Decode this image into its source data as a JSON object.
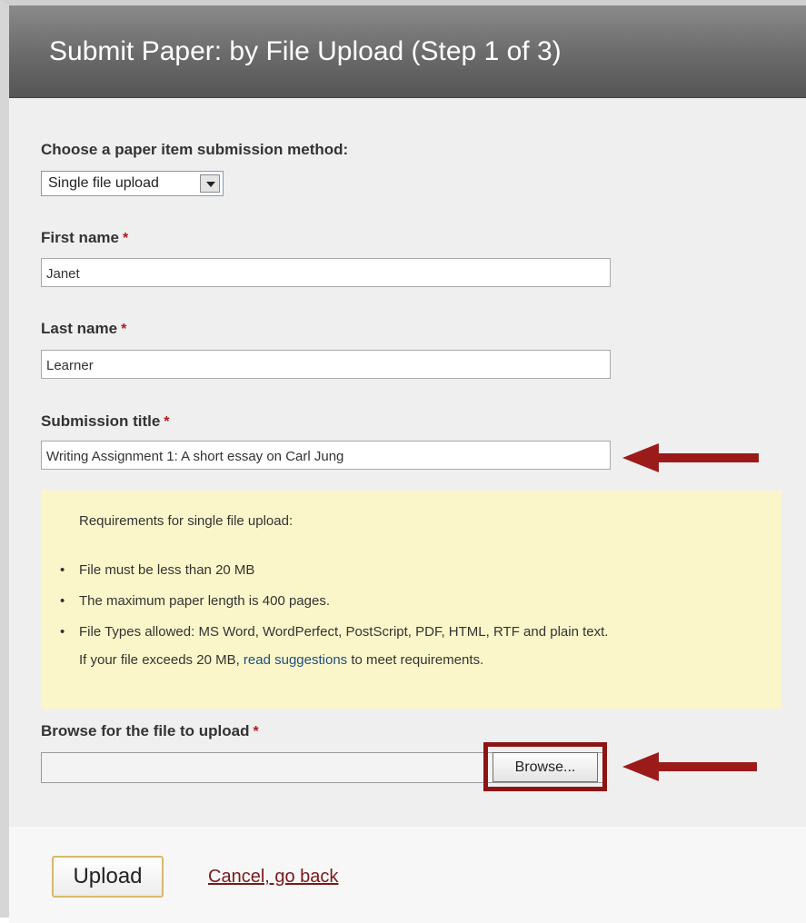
{
  "header": {
    "title": "Submit Paper: by File Upload (Step 1 of 3)"
  },
  "method": {
    "label": "Choose a paper item submission method:",
    "selected": "Single file upload"
  },
  "first_name": {
    "label": "First name",
    "required_mark": "*",
    "value": "Janet"
  },
  "last_name": {
    "label": "Last name",
    "required_mark": "*",
    "value": "Learner"
  },
  "submission_title": {
    "label": "Submission title",
    "required_mark": "*",
    "value": "Writing Assignment 1: A short essay on Carl Jung"
  },
  "requirements": {
    "heading": "Requirements for single file upload:",
    "bullet_glyph": "•",
    "items": [
      "File must be less than 20 MB",
      "The maximum paper length is 400 pages.",
      "File Types allowed: MS Word, WordPerfect, PostScript, PDF, HTML, RTF and plain text."
    ],
    "note_prefix": "If your file exceeds 20 MB, ",
    "note_link": "read suggestions",
    "note_suffix": " to meet requirements."
  },
  "file_upload": {
    "label": "Browse for the file to upload",
    "required_mark": "*",
    "browse_label": "Browse..."
  },
  "footer": {
    "upload_label": "Upload",
    "cancel_label": "Cancel, go back"
  },
  "colors": {
    "annotation_arrow": "#9b1b1b",
    "required_mark": "#b11b1b",
    "requirements_bg": "#fbf6c9"
  }
}
